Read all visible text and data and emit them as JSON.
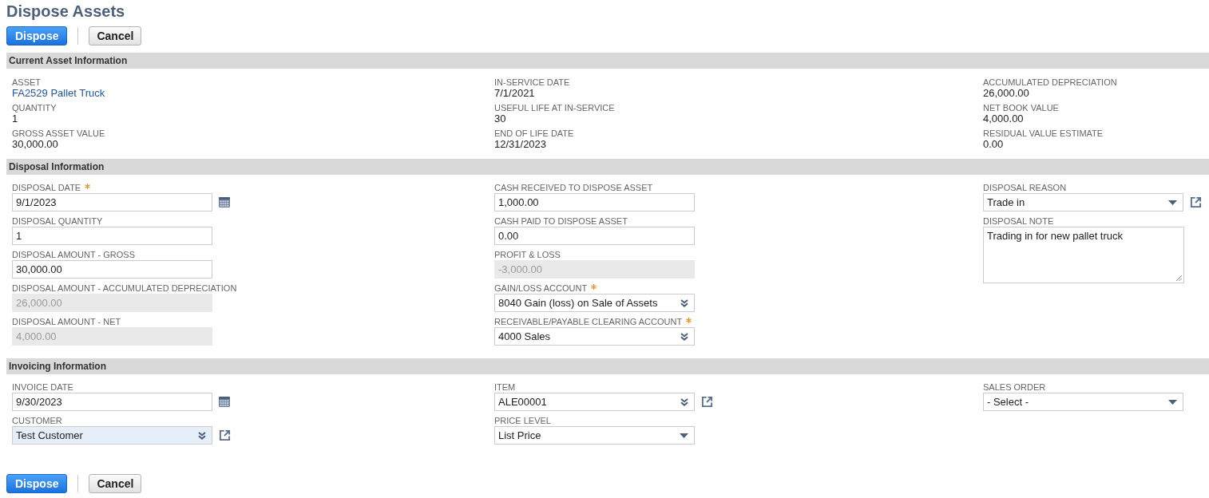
{
  "title": "Dispose Assets",
  "top_buttons": [
    {
      "label": "Dispose",
      "kind": "dispose"
    },
    {
      "label": "Cancel",
      "kind": "cancel"
    }
  ],
  "sections": [
    {
      "title": "Current Asset Information",
      "kind": "info",
      "columns": [
        [
          {
            "label": "ASSET",
            "value": "FA2529 Pallet Truck",
            "kind": "link"
          },
          {
            "label": "QUANTITY",
            "value": "1",
            "kind": "text"
          },
          {
            "label": "GROSS ASSET VALUE",
            "value": "30,000.00",
            "kind": "text"
          }
        ],
        [
          {
            "label": "IN-SERVICE DATE",
            "value": "7/1/2021",
            "kind": "text"
          },
          {
            "label": "USEFUL LIFE AT IN-SERVICE",
            "value": "30",
            "kind": "text"
          },
          {
            "label": "END OF LIFE DATE",
            "value": "12/31/2023",
            "kind": "text"
          }
        ],
        [
          {
            "label": "ACCUMULATED DEPRECIATION",
            "value": "26,000.00",
            "kind": "text"
          },
          {
            "label": "NET BOOK VALUE",
            "value": "4,000.00",
            "kind": "text"
          },
          {
            "label": "RESIDUAL VALUE ESTIMATE",
            "value": "0.00",
            "kind": "text"
          }
        ]
      ]
    },
    {
      "title": "Disposal Information",
      "kind": "form",
      "columns": [
        [
          {
            "label": "DISPOSAL DATE",
            "value": "9/1/2023",
            "kind": "date",
            "required": true,
            "disabled": false,
            "highlighted": false,
            "open_link": false
          },
          {
            "label": "DISPOSAL QUANTITY",
            "value": "1",
            "kind": "text",
            "required": false,
            "disabled": false,
            "highlighted": false,
            "open_link": false
          },
          {
            "label": "DISPOSAL AMOUNT - GROSS",
            "value": "30,000.00",
            "kind": "text",
            "required": false,
            "disabled": false,
            "highlighted": false,
            "open_link": false
          },
          {
            "label": "DISPOSAL AMOUNT - ACCUMULATED DEPRECIATION",
            "value": "26,000.00",
            "kind": "text",
            "required": false,
            "disabled": true,
            "highlighted": false,
            "open_link": false
          },
          {
            "label": "DISPOSAL AMOUNT - NET",
            "value": "4,000.00",
            "kind": "text",
            "required": false,
            "disabled": true,
            "highlighted": false,
            "open_link": false
          }
        ],
        [
          {
            "label": "CASH RECEIVED TO DISPOSE ASSET",
            "value": "1,000.00",
            "kind": "text",
            "required": false,
            "disabled": false,
            "highlighted": false,
            "open_link": false
          },
          {
            "label": "CASH PAID TO DISPOSE ASSET",
            "value": "0.00",
            "kind": "text",
            "required": false,
            "disabled": false,
            "highlighted": false,
            "open_link": false
          },
          {
            "label": "PROFIT & LOSS",
            "value": "-3,000.00",
            "kind": "text",
            "required": false,
            "disabled": true,
            "highlighted": false,
            "open_link": false
          },
          {
            "label": "GAIN/LOSS ACCOUNT",
            "value": "8040 Gain (loss) on Sale of Assets",
            "kind": "lookup",
            "required": true,
            "disabled": false,
            "highlighted": false,
            "open_link": false
          },
          {
            "label": "RECEIVABLE/PAYABLE CLEARING ACCOUNT",
            "value": "4000 Sales",
            "kind": "lookup",
            "required": true,
            "disabled": false,
            "highlighted": false,
            "open_link": false
          }
        ],
        [
          {
            "label": "DISPOSAL REASON",
            "value": "Trade in",
            "kind": "select",
            "required": false,
            "disabled": false,
            "highlighted": false,
            "open_link": true
          },
          {
            "label": "DISPOSAL NOTE",
            "value": "Trading in for new pallet truck",
            "kind": "textarea",
            "required": false,
            "disabled": false,
            "highlighted": false,
            "open_link": false
          }
        ]
      ]
    },
    {
      "title": "Invoicing Information",
      "kind": "form",
      "columns": [
        [
          {
            "label": "INVOICE DATE",
            "value": "9/30/2023",
            "kind": "date",
            "required": false,
            "disabled": false,
            "highlighted": false,
            "open_link": false
          },
          {
            "label": "CUSTOMER",
            "value": "Test Customer",
            "kind": "lookup",
            "required": false,
            "disabled": false,
            "highlighted": true,
            "open_link": true
          }
        ],
        [
          {
            "label": "ITEM",
            "value": "ALE00001",
            "kind": "lookup",
            "required": false,
            "disabled": false,
            "highlighted": false,
            "open_link": true
          },
          {
            "label": "PRICE LEVEL",
            "value": "List Price",
            "kind": "select",
            "required": false,
            "disabled": false,
            "highlighted": false,
            "open_link": false
          }
        ],
        [
          {
            "label": "SALES ORDER",
            "value": "- Select -",
            "kind": "select",
            "required": false,
            "disabled": false,
            "highlighted": false,
            "open_link": false
          }
        ]
      ]
    }
  ],
  "bottom_buttons": [
    {
      "label": "Dispose",
      "kind": "dispose"
    },
    {
      "label": "Cancel",
      "kind": "cancel"
    }
  ]
}
